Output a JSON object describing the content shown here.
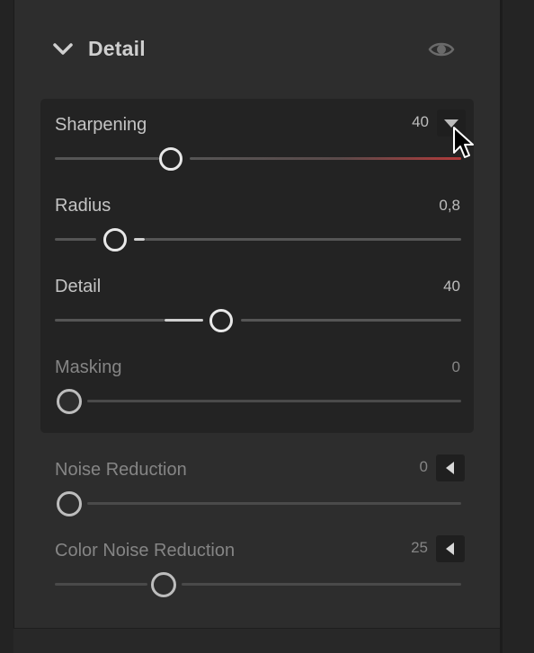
{
  "panel": {
    "title": "Detail",
    "visibility_icon": "eye-icon",
    "collapse_icon": "chevron-down-icon"
  },
  "sharpening": {
    "label": "Sharpening",
    "value": "40",
    "slider_level_fraction": 0.27,
    "menu_icon": "triangle-down-icon"
  },
  "radius": {
    "label": "Radius",
    "value": "0,8",
    "slider_level_fraction": 0.14
  },
  "detail": {
    "label": "Detail",
    "value": "40",
    "slider_level_fraction": 0.4
  },
  "masking": {
    "label": "Masking",
    "value": "0",
    "slider_level_fraction": 0
  },
  "noise_reduction": {
    "label": "Noise Reduction",
    "value": "0",
    "slider_level_fraction": 0,
    "expand_icon": "triangle-left-icon"
  },
  "color_noise_reduction": {
    "label": "Color Noise Reduction",
    "value": "25",
    "slider_level_fraction": 0.25,
    "expand_icon": "triangle-left-icon"
  },
  "colors": {
    "background": "#2d2d2d",
    "subpanel": "#232323",
    "accent_red": "#b03a3a",
    "knob_border": "#e8e8e8"
  }
}
